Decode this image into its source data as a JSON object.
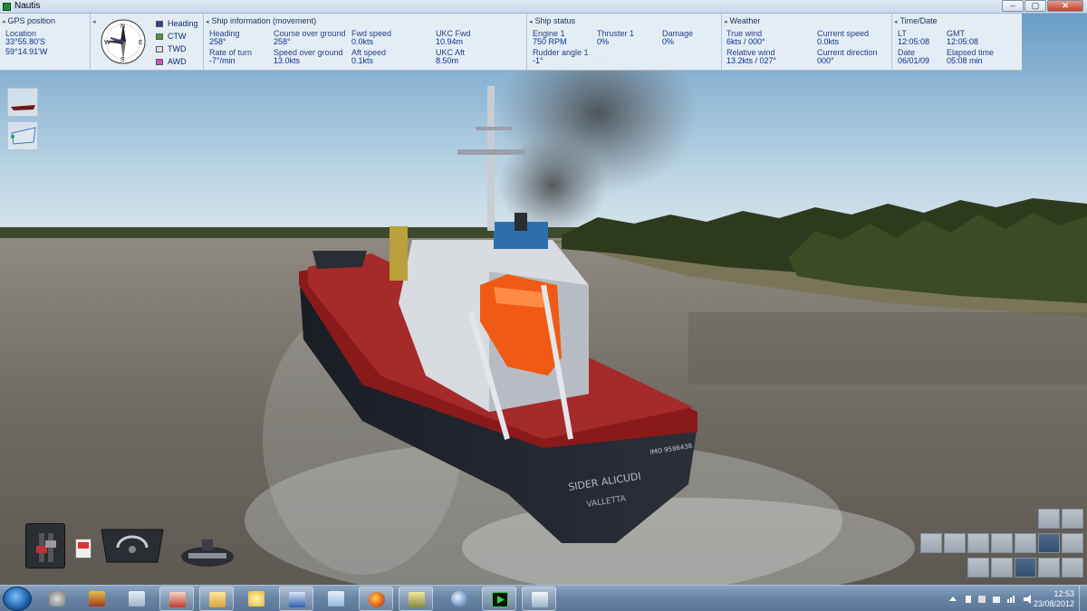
{
  "window": {
    "title": "Nautis"
  },
  "panels": {
    "gps": {
      "header": "GPS position",
      "location_label": "Location",
      "lat": "33°55.80'S",
      "lon": "59°14.91'W"
    },
    "compass": {
      "legend": [
        "Heading",
        "CTW",
        "TWD",
        "AWD"
      ],
      "colors": {
        "heading": "#3a3f8f",
        "ctw": "#4a9a3a",
        "twd": "#e0e0e0",
        "awd": "#d44fbf"
      },
      "cardinals": {
        "n": "N",
        "e": "E",
        "s": "S",
        "w": "W"
      }
    },
    "ship_info": {
      "header": "Ship information (movement)",
      "heading_label": "Heading",
      "heading": "258°",
      "rot_label": "Rate of turn",
      "rot": "-7°/min",
      "cog_label": "Course over ground",
      "cog": "258°",
      "sog_label": "Speed over ground",
      "sog": "13.0kts",
      "fwd_speed_label": "Fwd speed",
      "fwd_speed": "0.0kts",
      "aft_speed_label": "Aft speed",
      "aft_speed": "0.1kts",
      "ukc_fwd_label": "UKC Fwd",
      "ukc_fwd": "10.94m",
      "ukc_aft_label": "UKC Aft",
      "ukc_aft": "8.50m"
    },
    "ship_status": {
      "header": "Ship status",
      "engine_label": "Engine 1",
      "engine": "750 RPM",
      "rudder_label": "Rudder angle 1",
      "rudder": "-1°",
      "thruster_label": "Thruster 1",
      "thruster": "0%",
      "damage_label": "Damage",
      "damage": "0%"
    },
    "weather": {
      "header": "Weather",
      "true_wind_label": "True wind",
      "true_wind": "6kts / 000°",
      "rel_wind_label": "Relative wind",
      "rel_wind": "13.2kts / 027°",
      "cur_speed_label": "Current speed",
      "cur_speed": "0.0kts",
      "cur_dir_label": "Current direction",
      "cur_dir": "000°"
    },
    "time": {
      "header": "Time/Date",
      "lt_label": "LT",
      "lt": "12:05:08",
      "gmt_label": "GMT",
      "gmt": "12:05:08",
      "date_label": "Date",
      "date": "06/01/09",
      "elapsed_label": "Elapsed time",
      "elapsed": "05:08 min"
    }
  },
  "collapse_glyph": "◂",
  "ship": {
    "name": "SIDER ALICUDI",
    "port": "VALLETTA",
    "imo": "IMO 9586438"
  },
  "taskbar": {
    "time": "12:53",
    "date": "23/08/2012",
    "items": [
      "settings-app",
      "game-app",
      "calculator-app",
      "presentation-app",
      "folder-app",
      "weather-app",
      "word-app",
      "notepad-app",
      "firefox-app",
      "backup-app",
      "thunderbird-app",
      "nautis-app",
      "window-app"
    ]
  },
  "window_controls": {
    "minimize": "–",
    "maximize": "▢",
    "close": "✕"
  }
}
